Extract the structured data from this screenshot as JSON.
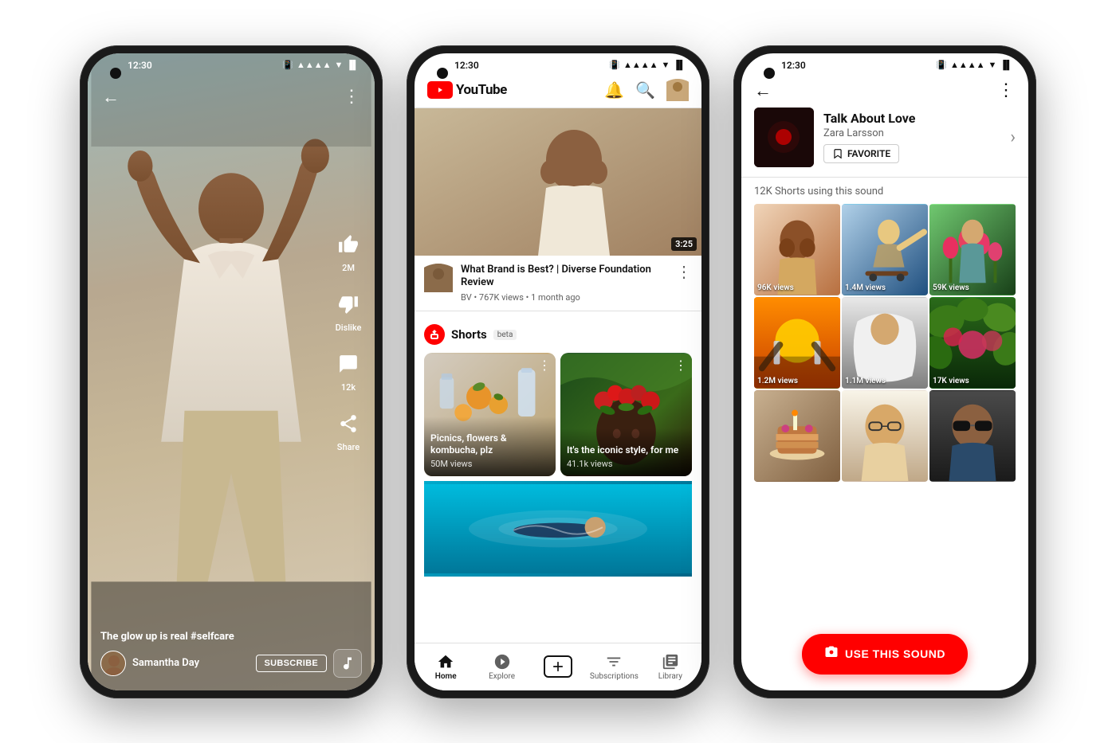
{
  "phones": {
    "phone1": {
      "status_time": "12:30",
      "type": "shorts_player",
      "video": {
        "caption": "The glow up is real",
        "hashtag": "#selfcare",
        "creator_name": "Samantha Day",
        "subscribe_label": "SUBSCRIBE",
        "likes": "2M",
        "dislike_label": "Dislike",
        "comments": "12k",
        "share_label": "Share"
      }
    },
    "phone2": {
      "status_time": "12:30",
      "type": "youtube_home",
      "header": {
        "logo_text": "YouTube",
        "bell_icon": "🔔",
        "search_icon": "🔍"
      },
      "video_card": {
        "title": "What Brand is Best? | Diverse Foundation Review",
        "channel": "BV",
        "views": "767K views",
        "age": "1 month ago",
        "duration": "3:25"
      },
      "shorts_section": {
        "title": "Shorts",
        "beta_label": "beta",
        "shorts": [
          {
            "caption": "Picnics, flowers & kombucha, plz",
            "views": "50M views"
          },
          {
            "caption": "It's the iconic style, for me",
            "views": "41.1k views"
          }
        ]
      },
      "bottom_nav": [
        {
          "icon": "🏠",
          "label": "Home",
          "active": true
        },
        {
          "icon": "🧭",
          "label": "Explore",
          "active": false
        },
        {
          "icon": "+",
          "label": "",
          "active": false
        },
        {
          "icon": "📋",
          "label": "Subscriptions",
          "active": false
        },
        {
          "icon": "📚",
          "label": "Library",
          "active": false
        }
      ]
    },
    "phone3": {
      "status_time": "12:30",
      "type": "sound_page",
      "sound": {
        "title": "Talk About Love",
        "artist": "Zara Larsson",
        "favorite_label": "FAVORITE",
        "count_label": "12K Shorts using this sound"
      },
      "videos": [
        {
          "views": "96K views",
          "style": "sv1"
        },
        {
          "views": "1.4M views",
          "style": "sv2"
        },
        {
          "views": "59K views",
          "style": "sv3"
        },
        {
          "views": "1.2M views",
          "style": "sv4"
        },
        {
          "views": "1.1M views",
          "style": "sv5"
        },
        {
          "views": "17K views",
          "style": "sv6"
        },
        {
          "views": "",
          "style": "sv7"
        },
        {
          "views": "",
          "style": "sv8"
        },
        {
          "views": "",
          "style": "sv9"
        }
      ],
      "use_sound_button": "USE THIS SOUND"
    }
  }
}
